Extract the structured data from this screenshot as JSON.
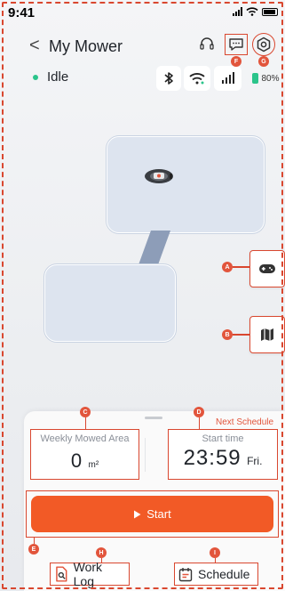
{
  "status_bar": {
    "time": "9:41"
  },
  "header": {
    "back_glyph": "<",
    "title": "My Mower",
    "icons": [
      "headset-icon",
      "message-icon",
      "settings-icon"
    ]
  },
  "device": {
    "state": "Idle",
    "state_color": "#2bc48b",
    "connectivity": [
      "bluetooth-icon",
      "wifi-icon",
      "cellular-icon"
    ],
    "battery": "80%"
  },
  "markers": {
    "a": "A",
    "b": "B",
    "c": "C",
    "d": "D",
    "e": "E",
    "f": "F",
    "g": "G",
    "h": "H",
    "i": "I"
  },
  "panel": {
    "next_schedule_label": "Next Schedule",
    "weekly_area": {
      "label": "Weekly Mowed Area",
      "value": "0",
      "unit": "m²"
    },
    "start_time": {
      "label": "Start time",
      "time": "23:59",
      "day": "Fri."
    },
    "start_button": "Start"
  },
  "tabs": {
    "work_log": "Work Log",
    "schedule": "Schedule"
  },
  "colors": {
    "accent": "#f25a26",
    "annotation": "#d9472f",
    "zone_fill": "#dde4ef"
  }
}
